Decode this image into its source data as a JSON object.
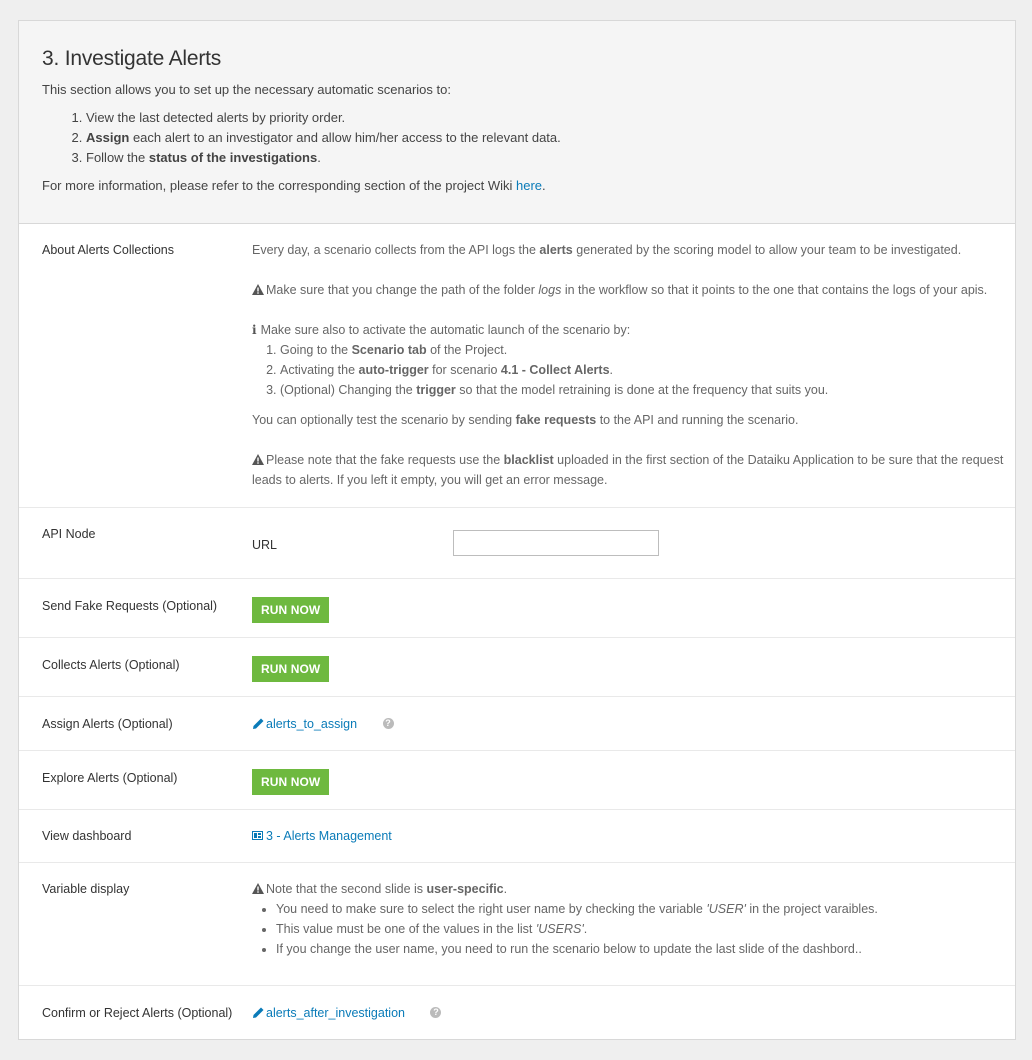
{
  "header": {
    "title": "3. Investigate Alerts",
    "intro": "This section allows you to set up the necessary automatic scenarios to:",
    "steps": [
      {
        "pre": "View the last detected alerts by priority order.",
        "bold": "",
        "post": ""
      },
      {
        "pre": "",
        "bold": "Assign",
        "post": " each alert to an investigator and allow him/her access to the relevant data."
      },
      {
        "pre": "Follow the ",
        "bold": "status of the investigations",
        "post": "."
      }
    ],
    "more_info": "For more information, please refer to the corresponding section of the project Wiki ",
    "more_info_link": "here",
    "more_info_end": "."
  },
  "about": {
    "label": "About Alerts Collections",
    "p1_pre": "Every day, a scenario collects from the API logs the ",
    "p1_bold": "alerts",
    "p1_post": " generated by the scoring model to allow your team to be investigated.",
    "p2_pre": "Make sure that you change the path of the folder ",
    "p2_italic": "logs",
    "p2_post": " in the workflow so that it points to the one that contains the logs of your apis.",
    "p3": "Make sure also to activate the automatic launch of the scenario by:",
    "steps": [
      {
        "pre": "Going to the ",
        "bold": "Scenario tab",
        "mid": " of the Project.",
        "bold2": "",
        "post": ""
      },
      {
        "pre": "Activating the ",
        "bold": "auto-trigger",
        "mid": " for scenario ",
        "bold2": "4.1 - Collect Alerts",
        "post": "."
      },
      {
        "pre": "(Optional) Changing the ",
        "bold": "trigger",
        "mid": " so that the model retraining is done at the frequency that suits you.",
        "bold2": "",
        "post": ""
      }
    ],
    "p4_pre": "You can optionally test the scenario by sending ",
    "p4_bold": "fake requests",
    "p4_post": " to the API and running the scenario.",
    "p5_pre": "Please note that the fake requests use the ",
    "p5_bold": "blacklist",
    "p5_post": " uploaded in the first section of the Dataiku Application to be sure that the request leads to alerts. If you left it empty, you will get an error message."
  },
  "api_node": {
    "label": "API Node",
    "url_label": "URL",
    "url_value": "",
    "url_placeholder": ""
  },
  "send_fake": {
    "label": "Send Fake Requests (Optional)",
    "button": "RUN NOW"
  },
  "collects": {
    "label": "Collects Alerts (Optional)",
    "button": "RUN NOW"
  },
  "assign": {
    "label": "Assign Alerts (Optional)",
    "link": "alerts_to_assign",
    "help": "?"
  },
  "explore": {
    "label": "Explore Alerts (Optional)",
    "button": "RUN NOW"
  },
  "dashboard": {
    "label": "View dashboard",
    "link": "3 - Alerts Management"
  },
  "variable": {
    "label": "Variable display",
    "note_pre": "Note that the second slide is ",
    "note_bold": "user-specific",
    "note_post": ".",
    "bullets": [
      {
        "pre": "You need to make sure to select the right user name by checking the variable ",
        "italic": "'USER'",
        "post": " in the project varaibles."
      },
      {
        "pre": "This value must be one of the values in the list ",
        "italic": "'USERS'",
        "post": "."
      },
      {
        "pre": "If you change the user name, you need to run the scenario below to update the last slide of the dashbord..",
        "italic": "",
        "post": ""
      }
    ]
  },
  "confirm": {
    "label": "Confirm or Reject Alerts (Optional)",
    "link": "alerts_after_investigation",
    "help": "?"
  },
  "colors": {
    "accent_link": "#0a7bb8",
    "run_button": "#6eb93f"
  }
}
